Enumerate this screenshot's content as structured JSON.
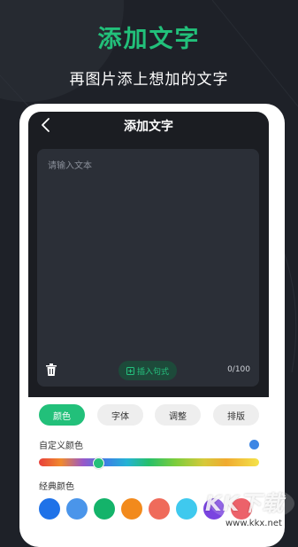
{
  "promo": {
    "title": "添加文字",
    "subtitle": "再图片添上想加的文字"
  },
  "app": {
    "title": "添加文字",
    "back_icon": "chevron-left-icon"
  },
  "editor": {
    "placeholder": "请输入文本",
    "value": "",
    "insert_label": "插入句式",
    "counter": "0/100",
    "delete_icon": "trash-icon"
  },
  "tabs": [
    {
      "label": "颜色",
      "active": true
    },
    {
      "label": "字体",
      "active": false
    },
    {
      "label": "调整",
      "active": false
    },
    {
      "label": "排版",
      "active": false
    }
  ],
  "color_panel": {
    "custom_label": "自定义颜色",
    "selected_color": "#3d86e4",
    "classic_label": "经典颜色",
    "classic_colors": [
      "#1f72e8",
      "#4a95ea",
      "#14b36a",
      "#f28a1c",
      "#ef6b5b",
      "#3fc9ee",
      "#7a44e0",
      "#e8404a"
    ]
  },
  "watermark": {
    "text": "KK下载",
    "url": "www.kkx.net"
  },
  "colors": {
    "accent": "#22c07a",
    "background": "#1e2128",
    "screen": "#1b1d22",
    "editor": "#2b2f37"
  }
}
